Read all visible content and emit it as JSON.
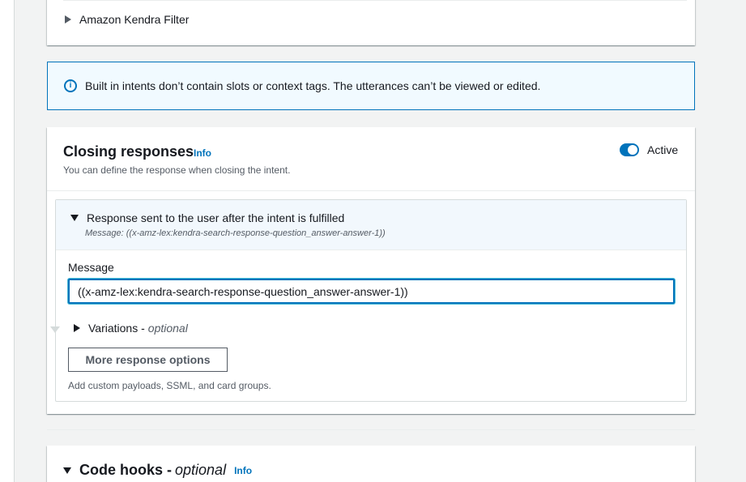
{
  "kendra_filter": {
    "label": "Amazon Kendra Filter"
  },
  "alert": {
    "text": "Built in intents don’t contain slots or context tags. The utterances can’t be viewed or edited."
  },
  "closing_responses": {
    "title": "Closing responses",
    "info_label": "Info",
    "description": "You can define the response when closing the intent.",
    "toggle_label": "Active",
    "toggle_on": true,
    "accent_color": "#0073bb",
    "response": {
      "header": "Response sent to the user after the intent is fulfilled",
      "subtitle": "Message: ((x-amz-lex:kendra-search-response-question_answer-answer-1))",
      "message_label": "Message",
      "message_value": "((x-amz-lex:kendra-search-response-question_answer-answer-1))",
      "variations_label": "Variations -",
      "variations_optional": "optional",
      "more_button": "More response options",
      "more_description": "Add custom payloads, SSML, and card groups."
    }
  },
  "code_hooks": {
    "title": "Code hooks -",
    "optional": "optional",
    "info_label": "Info"
  }
}
